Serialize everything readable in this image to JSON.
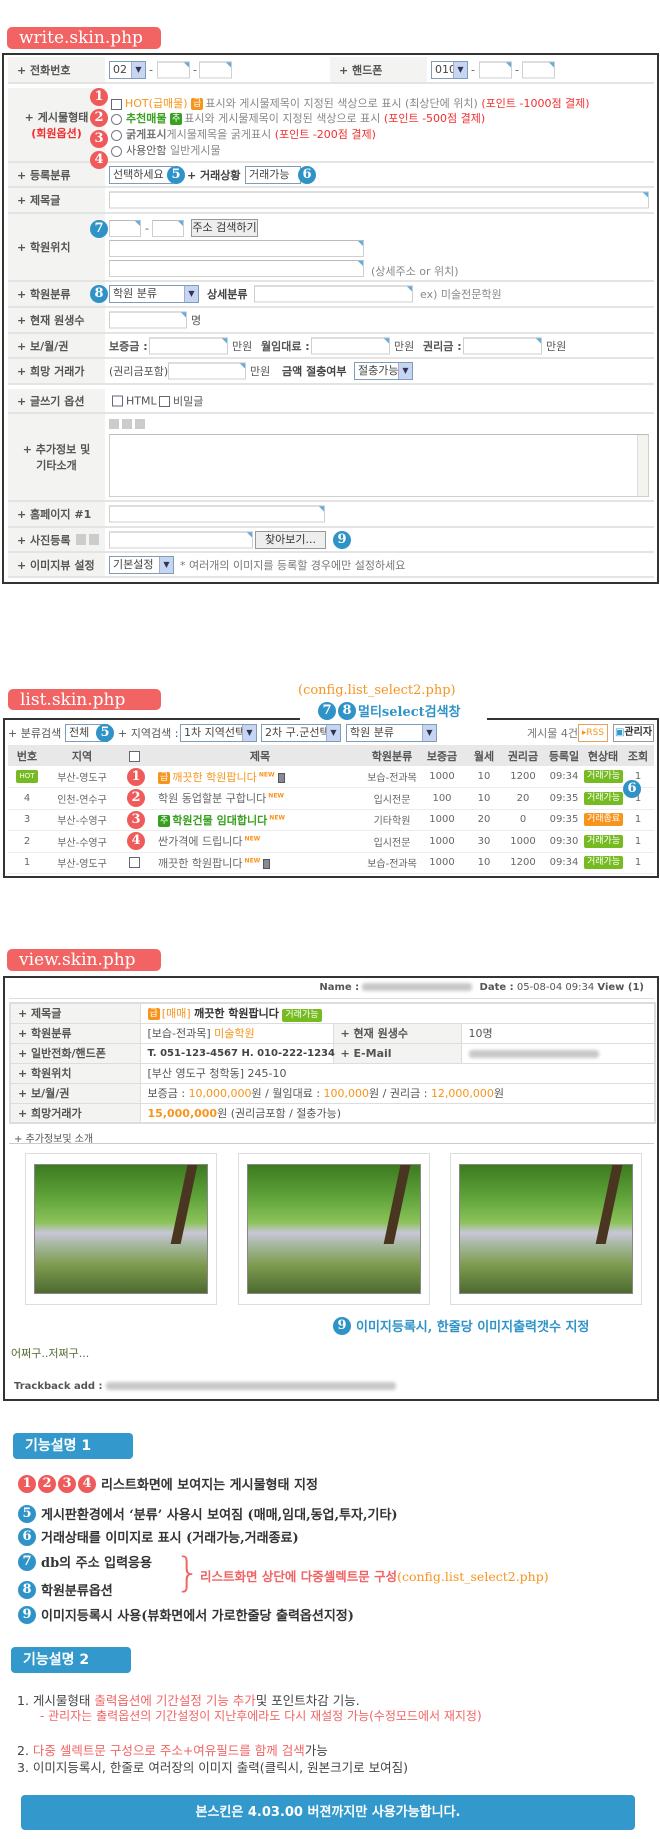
{
  "colors": {
    "tag_red": "#f26464",
    "accent_blue": "#3399cc",
    "status_green": "#77bb22",
    "status_orange": "#f7941d"
  },
  "write": {
    "section_label": "write.skin.php",
    "phone": {
      "label": "+ 전화번호",
      "area_code": "02",
      "dash": "-"
    },
    "mobile": {
      "label": "+ 핸드폰",
      "prefix": "010"
    },
    "post_type": {
      "label": "+ 게시물형태",
      "sublabel": "(회원옵션)",
      "options": [
        {
          "num": "1",
          "name": "HOT(급매물)",
          "badge": "급",
          "desc": "표시와 게시물제목이 지정된 색상으로 표시 (최상단에 위치)",
          "cost": "(포인트 -1000점 결제)"
        },
        {
          "num": "2",
          "name": "추천매물",
          "badge": "추",
          "desc": "표시와 게시물제목이 지정된 색상으로 표시",
          "cost": "(포인트 -500점 결제)"
        },
        {
          "num": "3",
          "name": "굵게표시",
          "desc": "게시물제목을 굵게표시",
          "cost": "(포인트 -200점 결제)"
        },
        {
          "num": "4",
          "name": "사용안함",
          "desc": "일반게시물"
        }
      ]
    },
    "category": {
      "label": "+ 등록분류",
      "select": "선택하세요",
      "num": "5",
      "status_label": "+ 거래상황",
      "status_select": "거래가능",
      "status_num": "6"
    },
    "subject": {
      "label": "+ 제목글"
    },
    "location": {
      "label": "+ 학원위치",
      "num": "7",
      "search_button": "주소 검색하기",
      "hint": "(상세주소 or 위치)"
    },
    "academy_type": {
      "label": "+ 학원분류",
      "num": "8",
      "select": "학원 분류",
      "detail_label": "상세분류",
      "example": "ex) 미술전문학원"
    },
    "students": {
      "label": "+ 현재 원생수",
      "unit": "명"
    },
    "prices": {
      "label": "+ 보/월/권",
      "deposit": "보증금 :",
      "rent": "월임대료 :",
      "premium": "권리금 :",
      "unit": "만원"
    },
    "wanted": {
      "label": "+ 희망 거래가",
      "prefix": "(권리금포함)",
      "unit": "만원",
      "nego_label": "금액 절충여부",
      "nego_select": "절충가능"
    },
    "options": {
      "label": "+ 글쓰기 옵션",
      "html": "HTML",
      "secret": "비밀글"
    },
    "content": {
      "label_1": "+ 추가정보 및",
      "label_2": "기타소개"
    },
    "homepage": {
      "label": "+ 홈페이지 #1"
    },
    "photo": {
      "label": "+ 사진등록",
      "browse": "찾아보기...",
      "num": "9"
    },
    "imageview": {
      "label": "+ 이미지뷰 설정",
      "select": "기본설정",
      "note": "* 여러개의 이미지를 등록할 경우에만 설정하세요"
    }
  },
  "list": {
    "section_label": "list.skin.php",
    "config_note": "(config.list_select2.php)",
    "multi_nums": [
      "7",
      "8"
    ],
    "multi_label": "멀티select검색창",
    "category_search_label": "+ 분류검색 :",
    "category_select": "전체",
    "category_num": "5",
    "region_search_label": "+ 지역검색 :",
    "region1_select": "1차 지역선택",
    "region2_select": "2차 구.군선택",
    "academy_select": "학원 분류",
    "post_count": "게시물 4건",
    "rss_button": "RSS",
    "admin_button": "관리자",
    "status_num": "6",
    "columns": [
      "번호",
      "지역",
      "",
      "제목",
      "학원분류",
      "보증금",
      "월세",
      "권리금",
      "등록일",
      "현상태",
      "조회"
    ],
    "rows": [
      {
        "no": "HOT",
        "region": "부산-영도구",
        "marker": "1",
        "badge": "급",
        "title": "깨끗한 학원팝니다",
        "type": "보습-전과목",
        "deposit": "1000",
        "rent": "10",
        "premium": "1200",
        "date": "09:34",
        "status": "거래가능",
        "views": "1",
        "style": "hot",
        "file": true
      },
      {
        "no": "4",
        "region": "인천-연수구",
        "marker": "2",
        "title": "학원 동업할분 구합니다",
        "type": "입시전문",
        "deposit": "100",
        "rent": "10",
        "premium": "20",
        "date": "09:35",
        "status": "거래가능",
        "views": "1",
        "style": "normal"
      },
      {
        "no": "3",
        "region": "부산-수영구",
        "marker": "3",
        "badge": "추",
        "title": "학원건물 임대합니다",
        "type": "기타학원",
        "deposit": "1000",
        "rent": "20",
        "premium": "0",
        "date": "09:35",
        "status": "거래종료",
        "views": "1",
        "style": "rec"
      },
      {
        "no": "2",
        "region": "부산-수영구",
        "marker": "4",
        "title": "싼가격에 드립니다",
        "type": "입시전문",
        "deposit": "1000",
        "rent": "30",
        "premium": "1000",
        "date": "09:30",
        "status": "거래가능",
        "views": "1",
        "style": "normal"
      },
      {
        "no": "1",
        "region": "부산-영도구",
        "marker": "",
        "title": "깨끗한 학원팝니다",
        "type": "보습-전과목",
        "deposit": "1000",
        "rent": "10",
        "premium": "1200",
        "date": "09:34",
        "status": "거래가능",
        "views": "1",
        "style": "normal",
        "file": true
      }
    ],
    "new_label": "NEW"
  },
  "view": {
    "section_label": "view.skin.php",
    "name_label": "Name :",
    "date_label": "Date :",
    "date": "05-08-04 09:34",
    "views": "View (1)",
    "subject_label": "+ 제목글",
    "subject_badge": "급",
    "subject_tag": "[매매]",
    "subject": "깨끗한 학원팝니다",
    "subject_status": "거래가능",
    "type_label": "+ 학원분류",
    "type_main": "[보습-전과목]",
    "type_detail": "미술학원",
    "students_label": "+ 현재 원생수",
    "students": "10명",
    "phone_label": "+ 일반전화/핸드폰",
    "phone": "T. 051-123-4567  H. 010-222-1234",
    "email_label": "+ E-Mail",
    "location_label": "+ 학원위치",
    "location": "[부산 영도구 청학동] 245-10",
    "prices_label": "+ 보/월/권",
    "deposit_label": "보증금 : ",
    "deposit": "10,000,000",
    "rent_label": "원 / 월임대료 : ",
    "rent": "100,000",
    "premium_label": "원 / 권리금 : ",
    "premium": "12,000,000",
    "won": "원",
    "wanted_label": "+ 희망거래가",
    "wanted": "15,000,000",
    "wanted_suffix": "원 (권리금포함 / 절충가능)",
    "extra_label": "+ 추가정보및 소개",
    "image_note_num": "9",
    "image_note": "이미지등록시, 한줄당 이미지출력갯수 지정",
    "body": "어쩌구..저쩌구...",
    "trackback_label": "Trackback add :"
  },
  "features1": {
    "title": "기능설명 1",
    "items": [
      {
        "nums": [
          "1",
          "2",
          "3",
          "4"
        ],
        "text": "리스트화면에 보여지는 게시물형태 지정"
      },
      {
        "nums": [
          "5"
        ],
        "text": "게시판환경에서 ‘분류’ 사용시 보여짐 (매매,임대,동업,투자,기타)"
      },
      {
        "nums": [
          "6"
        ],
        "text": "거래상태를 이미지로 표시 (거래가능,거래종료)"
      },
      {
        "nums": [
          "7"
        ],
        "text": "db의 주소 입력응용"
      },
      {
        "nums": [
          "8"
        ],
        "text": "학원분류옵션"
      },
      {
        "nums": [
          "9"
        ],
        "text": "이미지등록시 사용(뷰화면에서 가로한줄당 출력옵션지정)"
      }
    ],
    "brace_note": "리스트화면 상단에 다중셀렉트문 구성",
    "brace_config": "(config.list_select2.php)"
  },
  "features2": {
    "title": "기능설명 2",
    "item1_prefix": "1. 게시물형태 ",
    "item1_red": "출력옵션에 기간설정 기능 추가",
    "item1_suffix": "및 포인트차감 기능.",
    "item1_sub": "- 관리자는 출력옵션의 기간설정이 지난후에라도 다시 재설정 가능(수정모드에서 재지정)",
    "item2_prefix": "2. ",
    "item2_red": "다중 셀렉트문 구성으로 주소+여유필드를 함께 검색",
    "item2_suffix": "가능",
    "item3": "3. 이미지등록시, 한줄로 여러장의 이미지 출력(클릭시, 원본크기로 보여짐)",
    "notice": "본스킨은 4.03.00 버젼까지만 사용가능합니다."
  }
}
